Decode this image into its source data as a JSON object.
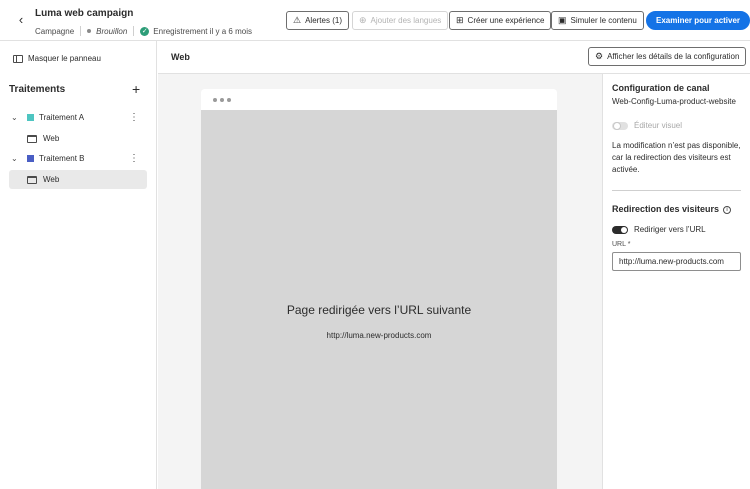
{
  "header": {
    "back_icon": "chevron-left-icon",
    "title": "Luma web campaign",
    "type": "Campagne",
    "status": "Brouillon",
    "saved": "Enregistrement il y a 6 mois",
    "alerts_label": "Alertes (1)",
    "add_languages_label": "Ajouter des langues",
    "create_experience_label": "Créer une expérience",
    "simulate_label": "Simuler le contenu",
    "review_label": "Examiner pour activer",
    "accent_color": "#1473e6"
  },
  "sidebar": {
    "hide_panel_label": "Masquer le panneau",
    "title": "Traitements",
    "treatments": [
      {
        "label": "Traitement A",
        "color": "#4ec5c1",
        "child": "Web"
      },
      {
        "label": "Traitement B",
        "color": "#4a5ec4",
        "child": "Web"
      }
    ]
  },
  "center": {
    "title": "Web",
    "config_button_label": "Afficher les détails de la configuration",
    "redirect_title": "Page redirigée vers l’URL suivante",
    "redirect_url": "http://luma.new-products.com"
  },
  "right_panel": {
    "channel_config_title": "Configuration de canal",
    "channel_config_value": "Web-Config-Luma-product-website",
    "visual_editor_label": "Éditeur visuel",
    "visual_editor_enabled": false,
    "notice_line1": "La modification n’est pas disponible,",
    "notice_line2": "car la redirection des visiteurs est",
    "notice_line3": "activée.",
    "redirect_section_title": "Redirection des visiteurs",
    "redirect_toggle_label": "Rediriger vers l’URL",
    "redirect_enabled": true,
    "url_label": "URL",
    "url_required_mark": "*",
    "url_value": "http://luma.new-products.com"
  }
}
